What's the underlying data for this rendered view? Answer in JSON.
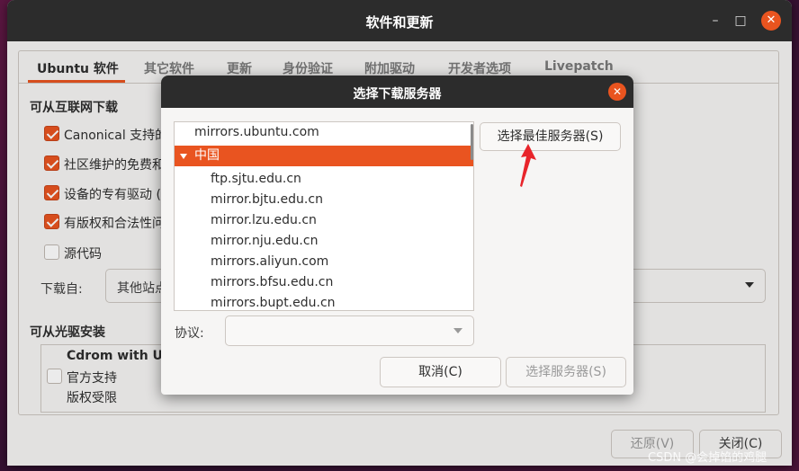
{
  "window": {
    "title": "软件和更新",
    "minimize_icon": "minimize-icon",
    "maximize_icon": "maximize-icon",
    "close_icon": "close-icon"
  },
  "tabs": [
    {
      "label": "Ubuntu 软件",
      "active": true
    },
    {
      "label": "其它软件"
    },
    {
      "label": "更新"
    },
    {
      "label": "身份验证"
    },
    {
      "label": "附加驱动"
    },
    {
      "label": "开发者选项"
    },
    {
      "label": "Livepatch"
    }
  ],
  "internet_section": {
    "title": "可从互联网下载",
    "items": [
      {
        "label": "Canonical 支持的",
        "checked": true
      },
      {
        "label": "社区维护的免费和",
        "checked": true
      },
      {
        "label": "设备的专有驱动 (",
        "checked": true
      },
      {
        "label": "有版权和合法性问",
        "checked": true
      },
      {
        "label": "源代码",
        "checked": false
      }
    ],
    "download_from_label": "下载自:",
    "download_from_value": "其他站点"
  },
  "cdrom_section": {
    "title": "可从光驱安装",
    "cd_name": "Cdrom with Ubu",
    "line1": "官方支持",
    "line2": "版权受限"
  },
  "bottom_buttons": {
    "revert": "还原(V)",
    "close": "关闭(C)"
  },
  "dialog": {
    "title": "选择下载服务器",
    "servers": [
      {
        "label": "mirrors.ubuntu.com",
        "level": 0
      },
      {
        "label": "中国",
        "level": 0,
        "selected": true,
        "expanded": true
      },
      {
        "label": "ftp.sjtu.edu.cn",
        "level": 1
      },
      {
        "label": "mirror.bjtu.edu.cn",
        "level": 1
      },
      {
        "label": "mirror.lzu.edu.cn",
        "level": 1
      },
      {
        "label": "mirror.nju.edu.cn",
        "level": 1
      },
      {
        "label": "mirrors.aliyun.com",
        "level": 1
      },
      {
        "label": "mirrors.bfsu.edu.cn",
        "level": 1
      },
      {
        "label": "mirrors.bupt.edu.cn",
        "level": 1
      }
    ],
    "best_server_button": "选择最佳服务器(S)",
    "protocol_label": "协议:",
    "protocol_value": "",
    "cancel_button": "取消(C)",
    "choose_server_button": "选择服务器(S)"
  },
  "watermark": "CSDN @会掉馅的鸡腿",
  "colors": {
    "accent": "#e95420",
    "titlebar": "#2c2c2c",
    "window_bg": "#f6f5f4",
    "annotation_arrow": "#e8242a"
  }
}
